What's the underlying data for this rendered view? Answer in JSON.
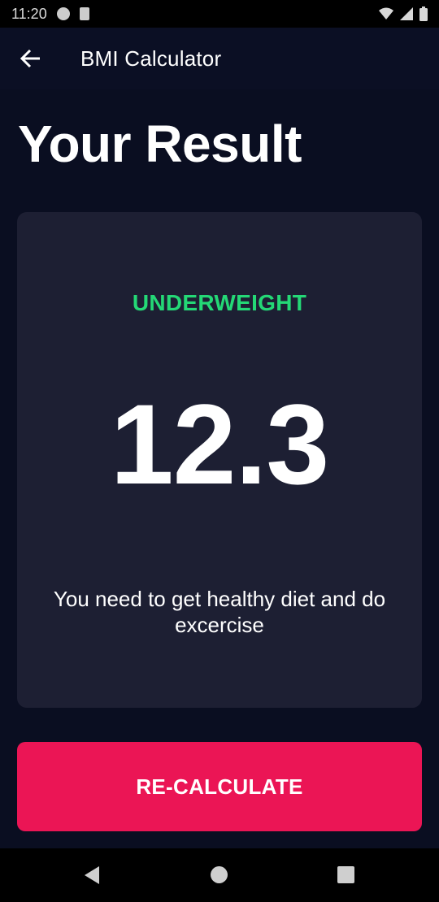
{
  "status_bar": {
    "time": "11:20"
  },
  "app_bar": {
    "title": "BMI Calculator"
  },
  "page": {
    "title": "Your Result"
  },
  "result": {
    "status": "UNDERWEIGHT",
    "bmi": "12.3",
    "advice": "You need to get healthy diet and do excercise"
  },
  "actions": {
    "recalculate_label": "RE-CALCULATE"
  },
  "colors": {
    "background": "#0a0e21",
    "card": "#1d1f33",
    "status_green": "#24d876",
    "accent_pink": "#eb1555"
  },
  "icons": {
    "back": "arrow-left-icon",
    "nav_back": "triangle-back-icon",
    "nav_home": "circle-home-icon",
    "nav_recents": "square-recents-icon"
  }
}
